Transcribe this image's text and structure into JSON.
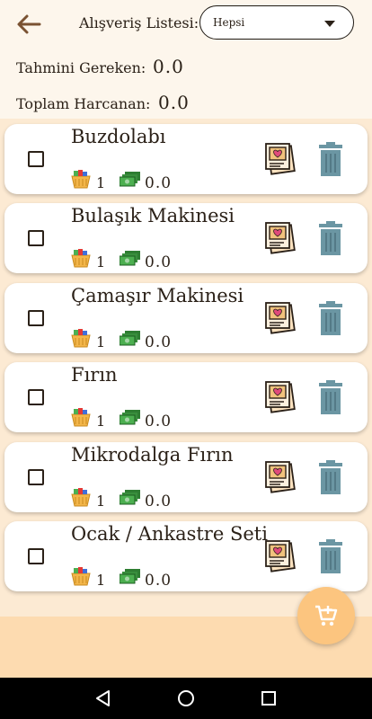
{
  "header": {
    "list_label": "Alışveriş Listesi:",
    "filter_value": "Hepsi",
    "estimated_label": "Tahmini Gereken:",
    "estimated_value": "0.0",
    "spent_label": "Toplam Harcanan:",
    "spent_value": "0.0"
  },
  "items": [
    {
      "name": "Buzdolabı",
      "quantity": "1",
      "price": "0.0",
      "checked": false
    },
    {
      "name": "Bulaşık Makinesi",
      "quantity": "1",
      "price": "0.0",
      "checked": false
    },
    {
      "name": "Çamaşır Makinesi",
      "quantity": "1",
      "price": "0.0",
      "checked": false
    },
    {
      "name": "Fırın",
      "quantity": "1",
      "price": "0.0",
      "checked": false
    },
    {
      "name": "Mikrodalga Fırın",
      "quantity": "1",
      "price": "0.0",
      "checked": false
    },
    {
      "name": "Ocak / Ankastre Seti",
      "quantity": "1",
      "price": "0.0",
      "checked": false
    }
  ],
  "icons": {
    "back": "arrow-left-icon",
    "dropdown": "caret-down-icon",
    "quantity": "basket-icon",
    "price": "money-icon",
    "edit": "product-card-heart-icon",
    "delete": "trash-icon",
    "add": "add-to-cart-icon"
  },
  "colors": {
    "background": "#fdf6ec",
    "list_background": "#fcead3",
    "bottom_bar": "#fddbb0",
    "fab": "#fcc57f",
    "trash": "#6b96a3",
    "text": "#2b2118"
  },
  "navigation": [
    "back-icon",
    "home-icon",
    "recents-icon"
  ]
}
